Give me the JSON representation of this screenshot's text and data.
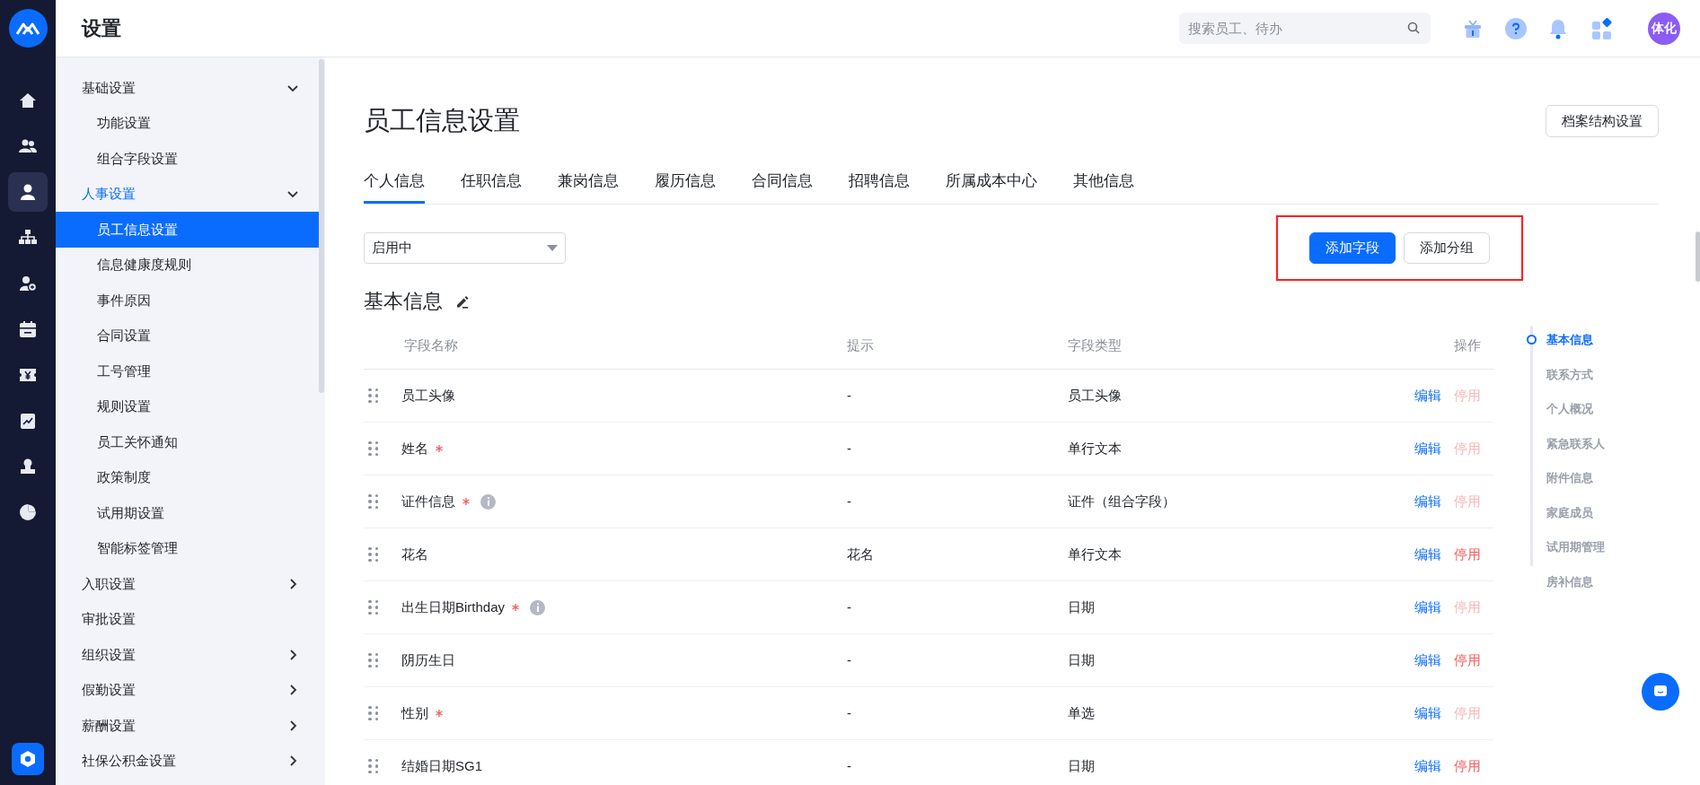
{
  "rail": {
    "items": [
      {
        "selected": false
      },
      {
        "selected": false
      },
      {
        "selected": true
      },
      {
        "selected": false
      },
      {
        "selected": false
      },
      {
        "selected": false
      },
      {
        "selected": false
      },
      {
        "selected": false
      },
      {
        "selected": false
      },
      {
        "selected": false
      }
    ]
  },
  "header": {
    "title": "设置",
    "search": {
      "placeholder": "搜索员工、待办"
    },
    "avatar": "体化"
  },
  "sidebar": {
    "items": [
      {
        "label": "基础设置",
        "expandable": true,
        "expanded": true,
        "active": false,
        "children": [
          {
            "label": "功能设置",
            "selected": false
          },
          {
            "label": "组合字段设置",
            "selected": false
          }
        ]
      },
      {
        "label": "人事设置",
        "expandable": true,
        "expanded": true,
        "active": true,
        "children": [
          {
            "label": "员工信息设置",
            "selected": true
          },
          {
            "label": "信息健康度规则",
            "selected": false
          },
          {
            "label": "事件原因",
            "selected": false
          },
          {
            "label": "合同设置",
            "selected": false
          },
          {
            "label": "工号管理",
            "selected": false
          },
          {
            "label": "规则设置",
            "selected": false
          },
          {
            "label": "员工关怀通知",
            "selected": false
          },
          {
            "label": "政策制度",
            "selected": false
          },
          {
            "label": "试用期设置",
            "selected": false
          },
          {
            "label": "智能标签管理",
            "selected": false
          }
        ]
      },
      {
        "label": "入职设置",
        "expandable": true,
        "expanded": false,
        "active": false
      },
      {
        "label": "审批设置",
        "expandable": false,
        "expanded": false,
        "active": false
      },
      {
        "label": "组织设置",
        "expandable": true,
        "expanded": false,
        "active": false
      },
      {
        "label": "假勤设置",
        "expandable": true,
        "expanded": false,
        "active": false
      },
      {
        "label": "薪酬设置",
        "expandable": true,
        "expanded": false,
        "active": false
      },
      {
        "label": "社保公积金设置",
        "expandable": true,
        "expanded": false,
        "active": false
      }
    ]
  },
  "page": {
    "title": "员工信息设置",
    "structure_button": "档案结构设置",
    "tabs": [
      {
        "label": "个人信息",
        "selected": true
      },
      {
        "label": "任职信息",
        "selected": false
      },
      {
        "label": "兼岗信息",
        "selected": false
      },
      {
        "label": "履历信息",
        "selected": false
      },
      {
        "label": "合同信息",
        "selected": false
      },
      {
        "label": "招聘信息",
        "selected": false
      },
      {
        "label": "所属成本中心",
        "selected": false
      },
      {
        "label": "其他信息",
        "selected": false
      }
    ],
    "status_select": {
      "value": "启用中"
    },
    "buttons": [
      {
        "label": "添加字段",
        "kind": "primary"
      },
      {
        "label": "添加分组",
        "kind": "default"
      }
    ],
    "section": {
      "title": "基本信息"
    },
    "table": {
      "columns": [
        "字段名称",
        "提示",
        "字段类型",
        "操作"
      ],
      "rows": [
        {
          "name": "员工头像",
          "required": false,
          "info": false,
          "hint": "-",
          "type": "员工头像",
          "edit": "编辑",
          "disable": "停用",
          "disable_enabled": false
        },
        {
          "name": "姓名",
          "required": true,
          "info": false,
          "hint": "-",
          "type": "单行文本",
          "edit": "编辑",
          "disable": "停用",
          "disable_enabled": false
        },
        {
          "name": "证件信息",
          "required": true,
          "info": true,
          "hint": "-",
          "type": "证件（组合字段）",
          "edit": "编辑",
          "disable": "停用",
          "disable_enabled": false
        },
        {
          "name": "花名",
          "required": false,
          "info": false,
          "hint": "花名",
          "type": "单行文本",
          "edit": "编辑",
          "disable": "停用",
          "disable_enabled": true
        },
        {
          "name": "出生日期Birthday",
          "required": true,
          "info": true,
          "hint": "-",
          "type": "日期",
          "edit": "编辑",
          "disable": "停用",
          "disable_enabled": false
        },
        {
          "name": "阴历生日",
          "required": false,
          "info": false,
          "hint": "-",
          "type": "日期",
          "edit": "编辑",
          "disable": "停用",
          "disable_enabled": true
        },
        {
          "name": "性别",
          "required": true,
          "info": false,
          "hint": "-",
          "type": "单选",
          "edit": "编辑",
          "disable": "停用",
          "disable_enabled": false
        },
        {
          "name": "结婚日期SG1",
          "required": false,
          "info": false,
          "hint": "-",
          "type": "日期",
          "edit": "编辑",
          "disable": "停用",
          "disable_enabled": true
        }
      ]
    },
    "anchors": [
      {
        "label": "基本信息",
        "selected": true
      },
      {
        "label": "联系方式",
        "selected": false
      },
      {
        "label": "个人概况",
        "selected": false
      },
      {
        "label": "紧急联系人",
        "selected": false
      },
      {
        "label": "附件信息",
        "selected": false
      },
      {
        "label": "家庭成员",
        "selected": false
      },
      {
        "label": "试用期管理",
        "selected": false
      },
      {
        "label": "房补信息",
        "selected": false
      }
    ]
  }
}
